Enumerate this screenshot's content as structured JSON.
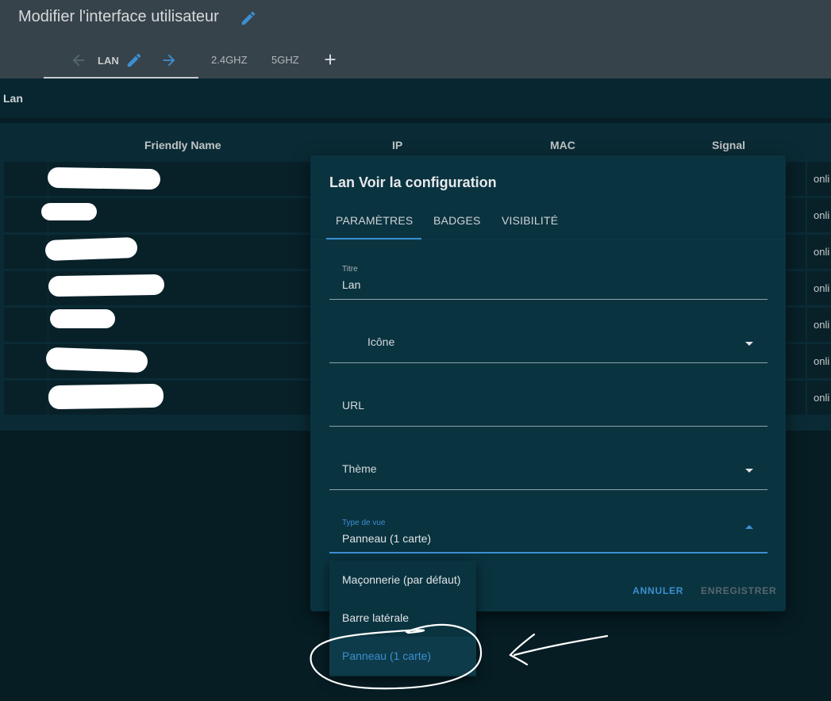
{
  "header": {
    "title": "Modifier l'interface utilisateur",
    "tabs": [
      {
        "label": "LAN"
      },
      {
        "label": "2.4GHZ"
      },
      {
        "label": "5GHZ"
      }
    ]
  },
  "card": {
    "title": "Lan",
    "table": {
      "columns": [
        "Friendly Name",
        "IP",
        "MAC",
        "Signal"
      ],
      "rows": [
        {
          "status": "onli"
        },
        {
          "status": "onli"
        },
        {
          "status": "onli"
        },
        {
          "status": "onli"
        },
        {
          "status": "onli"
        },
        {
          "status": "onli"
        },
        {
          "status": "onli"
        }
      ]
    }
  },
  "dialog": {
    "title": "Lan Voir la configuration",
    "tabs": [
      "PARAMÈTRES",
      "BADGES",
      "VISIBILITÉ"
    ],
    "fields": {
      "titre": {
        "label": "Titre",
        "value": "Lan"
      },
      "icone": {
        "placeholder": "Icône"
      },
      "url": {
        "placeholder": "URL"
      },
      "theme": {
        "placeholder": "Thème"
      },
      "type_vue": {
        "label": "Type de vue",
        "value": "Panneau (1 carte)"
      }
    },
    "buttons": {
      "cancel": "ANNULER",
      "save": "ENREGISTRER"
    }
  },
  "menu": {
    "items": [
      "Maçonnerie (par défaut)",
      "Barre latérale",
      "Panneau (1 carte)"
    ],
    "selected": "Panneau (1 carte)"
  },
  "colors": {
    "accent": "#3c8fd0",
    "header_bg": "#37434b",
    "page_bg": "#061d24",
    "dialog_bg": "#0a3340"
  },
  "icons": [
    "pencil-icon",
    "arrow-left-icon",
    "arrow-right-icon",
    "plus-icon",
    "caret-down-icon",
    "caret-up-icon"
  ]
}
